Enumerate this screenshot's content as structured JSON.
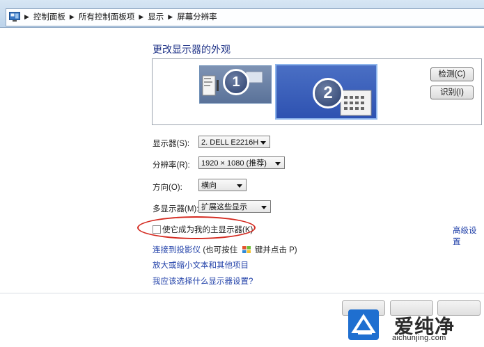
{
  "breadcrumb": {
    "items": [
      "控制面板",
      "所有控制面板项",
      "显示",
      "屏幕分辨率"
    ]
  },
  "page": {
    "heading": "更改显示器的外观"
  },
  "preview": {
    "monitor1": "1",
    "monitor2": "2",
    "detect_button": "检测(C)",
    "identify_button": "识别(I)"
  },
  "settings": {
    "display_label": "显示器(S):",
    "display_value": "2. DELL E2216H",
    "resolution_label": "分辨率(R):",
    "resolution_value": "1920 × 1080 (推荐)",
    "orientation_label": "方向(O):",
    "orientation_value": "横向",
    "multi_label": "多显示器(M):",
    "multi_value": "扩展这些显示"
  },
  "primary": {
    "checkbox_label": "使它成为我的主显示器(K)",
    "checked": false
  },
  "links": {
    "advanced": "高级设置",
    "projector": "连接到投影仪",
    "projector_hint_pre": "(也可按住",
    "projector_hint_post": "键并点击 P)",
    "text_size": "放大或缩小文本和其他项目",
    "which_settings": "我应该选择什么显示器设置?"
  },
  "watermark": {
    "text": "爱纯净",
    "url": "aichunjing.com"
  },
  "colors": {
    "accent_link": "#1f3fa8",
    "heading": "#1e3287",
    "annotation_ring": "#d42a20",
    "selected_monitor": "#2e52b1"
  }
}
